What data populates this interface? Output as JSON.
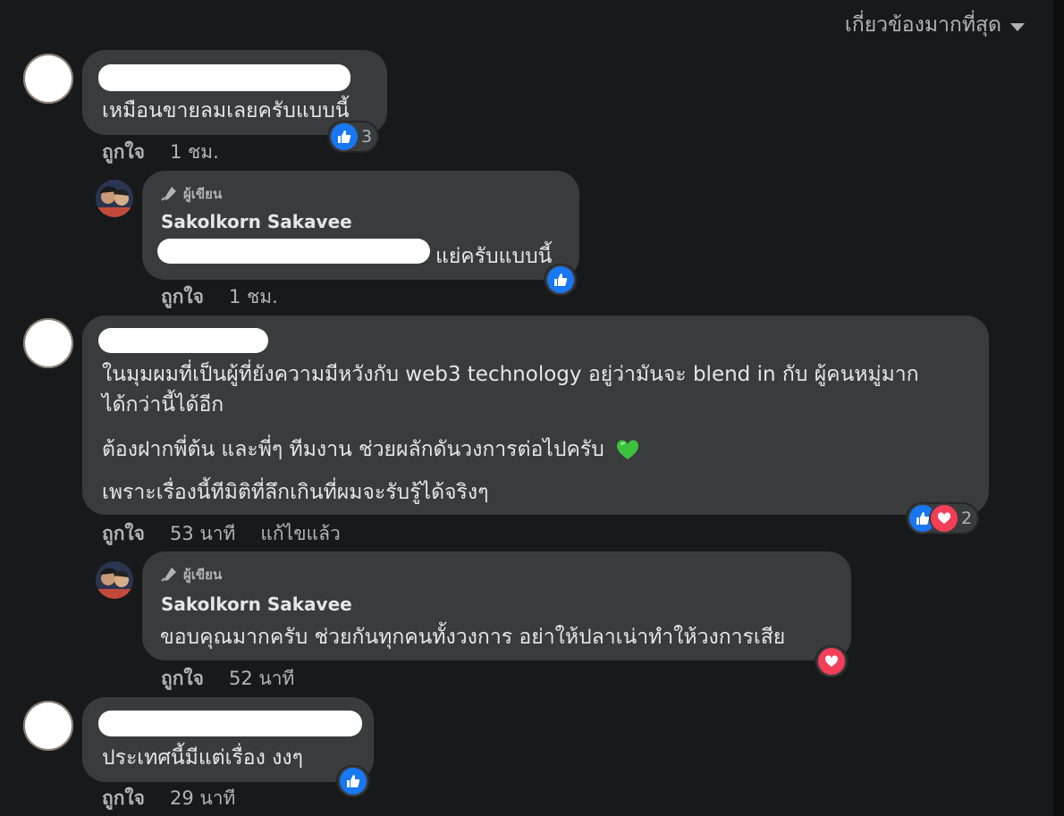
{
  "sort": {
    "label": "เกี่ยวข้องมากที่สุด"
  },
  "author_badge": "ผู้เขียน",
  "actions": {
    "like": "ถูกใจ",
    "edited": "แก้ไขแล้ว"
  },
  "comments": [
    {
      "text": "เหมือนขายลมเลยครับแบบนี้",
      "time": "1 ชม.",
      "reaction_count": "3",
      "reply": {
        "author": "Sakolkorn Sakavee",
        "text_suffix": "แย่ครับแบบนี้",
        "time": "1 ชม."
      }
    },
    {
      "text_lines": [
        "ในมุมผมที่เป็นผู้ที่ยังความมีหวังกับ web3 technology อยู่ว่ามันจะ blend in กับ ผู้คนหมู่มาก",
        "ได้กว่านี้ได้อีก",
        "ต้องฝากพี่ต้น และพี่ๆ ทีมงาน ช่วยผลักดันวงการต่อไปครับ",
        "เพราะเรื่องนี้ทีมิติที่ลึกเกินที่ผมจะรับรู้ได้จริงๆ"
      ],
      "time": "53 นาที",
      "reaction_count": "2",
      "reply": {
        "author": "Sakolkorn Sakavee",
        "text": "ขอบคุณมากครับ ช่วยกันทุกคนทั้งวงการ อย่าให้ปลาเน่าทำให้วงการเสีย",
        "time": "52 นาที"
      }
    },
    {
      "text": "ประเทศนี้มีแต่เรื่อง งงๆ",
      "time": "29 นาที"
    }
  ],
  "colors": {
    "like": "#1877f2",
    "love": "#f33e58",
    "bubble": "#3a3b3c",
    "background": "#18191a"
  }
}
